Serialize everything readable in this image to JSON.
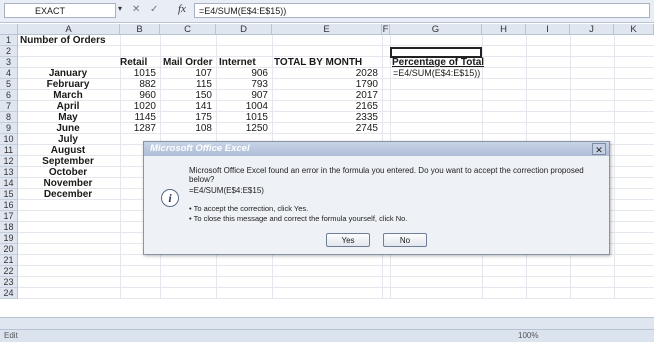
{
  "formula_bar": {
    "name_box": "EXACT",
    "formula": "=E4/SUM(E$4:E$15))"
  },
  "columns": [
    "A",
    "B",
    "C",
    "D",
    "E",
    "F",
    "G",
    "H",
    "I",
    "J",
    "K"
  ],
  "rows": [
    "1",
    "2",
    "3",
    "4",
    "5",
    "6",
    "7",
    "8",
    "9",
    "10",
    "11",
    "12",
    "13",
    "14",
    "15",
    "16",
    "17",
    "18",
    "19",
    "20",
    "21",
    "22",
    "23",
    "24"
  ],
  "sheet": {
    "title": "Number of Orders",
    "headers": [
      "Retail",
      "Mail Order",
      "Internet",
      "TOTAL BY MONTH"
    ],
    "pct_header": "Percentage of Total",
    "pct_formula": "=E4/SUM(E$4:E$15))",
    "months": [
      "January",
      "February",
      "March",
      "April",
      "May",
      "June",
      "July",
      "August",
      "September",
      "October",
      "November",
      "December"
    ],
    "data": [
      [
        "1015",
        "107",
        "906",
        "2028"
      ],
      [
        "882",
        "115",
        "793",
        "1790"
      ],
      [
        "960",
        "150",
        "907",
        "2017"
      ],
      [
        "1020",
        "141",
        "1004",
        "2165"
      ],
      [
        "1145",
        "175",
        "1015",
        "2335"
      ],
      [
        "1287",
        "108",
        "1250",
        "2745"
      ]
    ]
  },
  "dialog": {
    "title": "Microsoft Office Excel",
    "message": "Microsoft Office Excel found an error in the formula you entered. Do you want to accept the correction proposed below?",
    "proposed": "=E4/SUM(E$4:E$15)",
    "bullet1": "• To accept the correction, click Yes.",
    "bullet2": "• To close this message and correct the formula yourself, click No.",
    "yes": "Yes",
    "no": "No",
    "close": "✕"
  },
  "status": {
    "mode": "Edit",
    "zoom": "100%"
  }
}
